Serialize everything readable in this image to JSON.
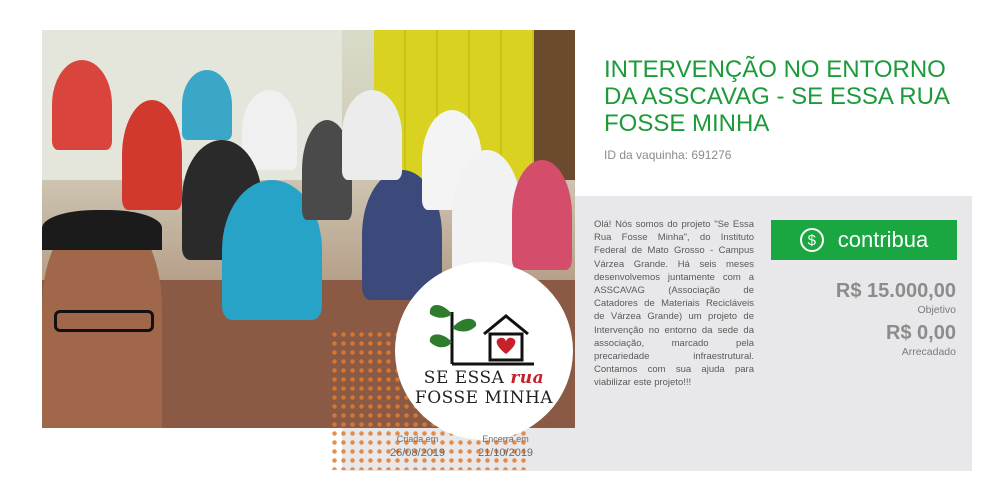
{
  "campaign": {
    "title": "INTERVENÇÃO NO ENTORNO DA ASSCAVAG - SE ESSA RUA FOSSE MINHA",
    "id_label": "ID da vaquinha: 691276",
    "description": "Olá! Nós somos do projeto \"Se Essa Rua Fosse Minha\", do Instituto Federal de Mato Grosso - Campus Várzea Grande. Há seis meses desenvolvemos juntamente com a ASSCAVAG (Associação de Catadores de Materiais Recicláveis de Várzea Grande) um projeto de Intervenção no entorno da sede da associação, marcado pela precariedade infraestrutural. Contamos com sua ajuda para viabilizar este projeto!!!"
  },
  "button": {
    "label": "contribua",
    "icon": "dollar-icon"
  },
  "goal": {
    "value": "R$ 15.000,00",
    "label": "Objetivo"
  },
  "raised": {
    "value": "R$ 0,00",
    "label": "Arrecadado"
  },
  "dates": {
    "created_label": "Criada em",
    "created_value": "26/08/2019",
    "ends_label": "Encerra em",
    "ends_value": "21/10/2019"
  },
  "logo": {
    "line1_prefix": "SE ESSA",
    "line1_script": "rua",
    "line2": "FOSSE MINHA"
  },
  "colors": {
    "accent": "#1aa640",
    "title": "#1d9a3a",
    "panel": "#e8e8ea"
  }
}
